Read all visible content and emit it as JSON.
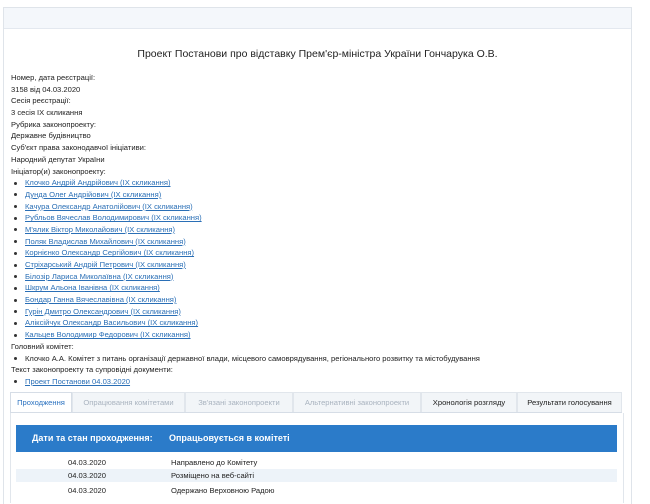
{
  "title": "Проект Постанови про відставку Прем'єр-міністра України Гончарука О.В.",
  "info": {
    "reg_label": "Номер, дата реєстрації:",
    "reg_value": "3158 від 04.03.2020",
    "session_label": "Сесія реєстрації:",
    "session_value": "3 сесія IX скликання",
    "rubric_label": "Рубрика законопроекту:",
    "rubric_value": "Державне будівництво",
    "subject_label": "Суб'єкт права законодавчої ініціативи:",
    "subject_value": "Народний депутат України",
    "initiators_label": "Ініціатор(и) законопроекту:"
  },
  "initiators": [
    "Клочко Андрій Андрійович (IX скликання)",
    "Дунда Олег Андрійович (IX скликання)",
    "Качура Олександр Анатолійович (IX скликання)",
    "Рубльов Вячеслав Володимирович (IX скликання)",
    "М'ялик Віктор Миколайович (IX скликання)",
    "Поляк Владислав Михайлович (IX скликання)",
    "Корнієнко Олександр Сергійович (IX скликання)",
    "Стріхарський Андрій Петрович (IX скликання)",
    "Білозір Лариса Миколаївна (IX скликання)",
    "Шкрум Альона Іванівна (IX скликання)",
    "Бондар Ганна Вячеславівна (IX скликання)",
    "Гурін Дмитро Олександрович (IX скликання)",
    "Аліксійчук Олександр Васильович (IX скликання)",
    "Кальцев Володимир Федорович (IX скликання)"
  ],
  "committee": {
    "label": "Головний комітет:",
    "value": "Клочко А.А. Комітет з питань організації державної влади, місцевого самоврядування, регіонального розвитку та містобудування"
  },
  "docs": {
    "label": "Текст законопроекту та супровідні документи:",
    "link": "Проект Постанови 04.03.2020"
  },
  "tabs": [
    "Проходження",
    "Опрацювання комітетами",
    "Зв'язані законопроекти",
    "Альтернативні законопроекти",
    "Хронологія розгляду",
    "Результати голосування"
  ],
  "table": {
    "header_left": "Дати та стан проходження:",
    "header_right": "Опрацьовується в комітеті",
    "rows": [
      {
        "date": "04.03.2020",
        "status": "Направлено до Комітету"
      },
      {
        "date": "04.03.2020",
        "status": "Розміщено на веб-сайті"
      },
      {
        "date": "04.03.2020",
        "status": "Одержано Верховною Радою"
      }
    ]
  }
}
